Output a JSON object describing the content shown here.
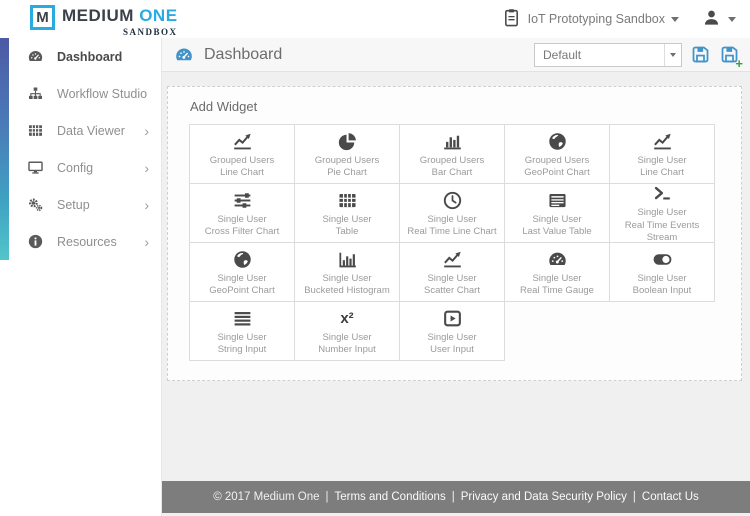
{
  "brand": {
    "logo_letter": "M",
    "name": "MEDIUM",
    "name_accent": "ONE",
    "tagline": "SANDBOX"
  },
  "topbar": {
    "environment_label": "IoT Prototyping Sandbox",
    "environment_icon": "clipboard-icon",
    "user_icon": "user-icon"
  },
  "sidebar": {
    "items": [
      {
        "label": "Dashboard",
        "icon": "gauge-icon",
        "active": true,
        "submenu": false
      },
      {
        "label": "Workflow Studio",
        "icon": "sitemap-icon",
        "active": false,
        "submenu": false
      },
      {
        "label": "Data Viewer",
        "icon": "table-icon",
        "active": false,
        "submenu": true
      },
      {
        "label": "Config",
        "icon": "desktop-icon",
        "active": false,
        "submenu": true
      },
      {
        "label": "Setup",
        "icon": "cogs-icon",
        "active": false,
        "submenu": true
      },
      {
        "label": "Resources",
        "icon": "info-circle-icon",
        "active": false,
        "submenu": true
      }
    ]
  },
  "main": {
    "header": {
      "title": "Dashboard",
      "icon": "gauge-icon",
      "select_value": "Default",
      "actions": {
        "save": "save-icon",
        "save_new": "save-plus-icon"
      }
    },
    "panel": {
      "title": "Add Widget",
      "widgets": [
        {
          "icon": "line-chart-icon",
          "line1": "Grouped Users",
          "line2": "Line Chart"
        },
        {
          "icon": "pie-chart-icon",
          "line1": "Grouped Users",
          "line2": "Pie Chart"
        },
        {
          "icon": "bar-chart-icon",
          "line1": "Grouped Users",
          "line2": "Bar Chart"
        },
        {
          "icon": "globe-icon",
          "line1": "Grouped Users",
          "line2": "GeoPoint Chart"
        },
        {
          "icon": "line-chart-icon",
          "line1": "Single User",
          "line2": "Line Chart"
        },
        {
          "icon": "sliders-icon",
          "line1": "Single User",
          "line2": "Cross Filter Chart"
        },
        {
          "icon": "table-icon",
          "line1": "Single User",
          "line2": "Table"
        },
        {
          "icon": "clock-icon",
          "line1": "Single User",
          "line2": "Real Time Line Chart"
        },
        {
          "icon": "list-table-icon",
          "line1": "Single User",
          "line2": "Last Value Table"
        },
        {
          "icon": "terminal-icon",
          "line1": "Single User",
          "line2": "Real Time Events Stream"
        },
        {
          "icon": "globe-icon",
          "line1": "Single User",
          "line2": "GeoPoint Chart"
        },
        {
          "icon": "histogram-icon",
          "line1": "Single User",
          "line2": "Bucketed Histogram"
        },
        {
          "icon": "scatter-chart-icon",
          "line1": "Single User",
          "line2": "Scatter Chart"
        },
        {
          "icon": "gauge-icon",
          "line1": "Single User",
          "line2": "Real Time Gauge"
        },
        {
          "icon": "toggle-icon",
          "line1": "Single User",
          "line2": "Boolean Input"
        },
        {
          "icon": "align-justify-icon",
          "line1": "Single User",
          "line2": "String Input"
        },
        {
          "icon": "x-squared-icon",
          "line1": "Single User",
          "line2": "Number Input"
        },
        {
          "icon": "play-square-icon",
          "line1": "Single User",
          "line2": "User Input"
        }
      ]
    }
  },
  "footer": {
    "copyright": "© 2017 Medium One",
    "separator": "|",
    "links": [
      "Terms and Conditions",
      "Privacy and Data Security Policy",
      "Contact Us"
    ]
  },
  "colors": {
    "accent_blue": "#29abe2",
    "icon_blue": "#4193c9",
    "plus_green": "#35a13c",
    "gradient_top": "#4d59a6",
    "gradient_bottom": "#52c5c9",
    "footer_bg": "#7d7d7d",
    "main_bg": "#f0f0f0"
  }
}
